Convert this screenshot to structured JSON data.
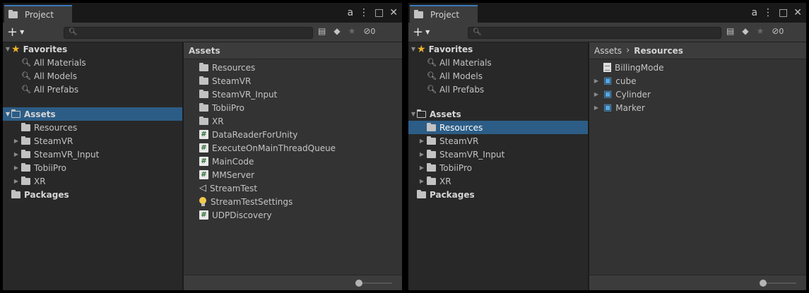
{
  "panels": [
    {
      "tab_title": "Project",
      "hidden_count": "0",
      "breadcrumb": [
        "Assets"
      ],
      "favorites": {
        "label": "Favorites",
        "items": [
          "All Materials",
          "All Models",
          "All Prefabs"
        ]
      },
      "tree": {
        "root": "Assets",
        "children": [
          "Resources",
          "SteamVR",
          "SteamVR_Input",
          "TobiiPro",
          "XR"
        ],
        "packages": "Packages",
        "selected": "Assets"
      },
      "content_items": [
        {
          "name": "Resources",
          "icon": "folder-icon"
        },
        {
          "name": "SteamVR",
          "icon": "folder-icon"
        },
        {
          "name": "SteamVR_Input",
          "icon": "folder-icon"
        },
        {
          "name": "TobiiPro",
          "icon": "folder-icon"
        },
        {
          "name": "XR",
          "icon": "folder-icon"
        },
        {
          "name": "DataReaderForUnity",
          "icon": "csharp-script-icon"
        },
        {
          "name": "ExecuteOnMainThreadQueue",
          "icon": "csharp-script-icon"
        },
        {
          "name": "MainCode",
          "icon": "csharp-script-icon"
        },
        {
          "name": "MMServer",
          "icon": "csharp-script-icon"
        },
        {
          "name": "StreamTest",
          "icon": "unity-scene-icon"
        },
        {
          "name": "StreamTestSettings",
          "icon": "lighting-settings-icon"
        },
        {
          "name": "UDPDiscovery",
          "icon": "csharp-script-icon"
        }
      ]
    },
    {
      "tab_title": "Project",
      "hidden_count": "0",
      "breadcrumb": [
        "Assets",
        "Resources"
      ],
      "favorites": {
        "label": "Favorites",
        "items": [
          "All Materials",
          "All Models",
          "All Prefabs"
        ]
      },
      "tree": {
        "root": "Assets",
        "children": [
          "Resources",
          "SteamVR",
          "SteamVR_Input",
          "TobiiPro",
          "XR"
        ],
        "packages": "Packages",
        "selected": "Resources"
      },
      "content_items": [
        {
          "name": "BillingMode",
          "icon": "text-asset-icon"
        },
        {
          "name": "cube",
          "icon": "prefab-icon"
        },
        {
          "name": "Cylinder",
          "icon": "prefab-icon"
        },
        {
          "name": "Marker",
          "icon": "prefab-icon"
        }
      ]
    }
  ],
  "colors": {
    "selection": "#2c5d87",
    "tab_accent": "#3a79bb",
    "star": "#f0b429",
    "prefab": "#53a8e8"
  }
}
